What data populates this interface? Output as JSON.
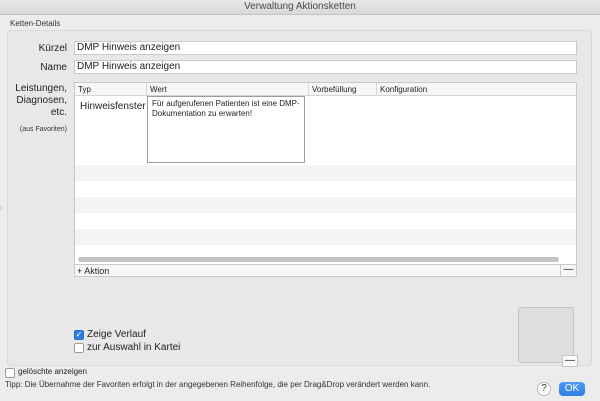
{
  "window": {
    "title": "Verwaltung Aktionsketten"
  },
  "group": {
    "title": "Ketten-Details"
  },
  "fields": {
    "kuerzel": {
      "label": "Kürzel",
      "value": "DMP Hinweis anzeigen"
    },
    "name": {
      "label": "Name",
      "value": "DMP Hinweis anzeigen"
    }
  },
  "leistungen": {
    "label_lines": [
      "Leistungen,",
      "Diagnosen,",
      "etc."
    ],
    "fav_note": "(aus Favoriten)"
  },
  "table": {
    "columns": [
      "Typ",
      "Wert",
      "Vorbefüllung",
      "Konfiguration"
    ],
    "rows": [
      {
        "typ": "Hinweisfenster",
        "wert": "Für aufgerufenen Patienten ist eine DMP-Dokumentation zu erwarten!",
        "vorbefuellung": "",
        "konfiguration": ""
      }
    ]
  },
  "table_bar": {
    "add_label": "+ Aktion",
    "remove_label": "—"
  },
  "options": {
    "zeige_verlauf": {
      "label": "Zeige Verlauf",
      "checked": true
    },
    "zur_auswahl": {
      "label": "zur Auswahl in Kartei",
      "checked": false
    }
  },
  "preview": {
    "remove_label": "—"
  },
  "footer": {
    "geloeschte": {
      "label": "gelöschte anzeigen",
      "checked": false
    },
    "tip": "Tipp: Die Übernahme der Favoriten erfolgt in der angegebenen Reihenfolge, die per Drag&Drop verändert werden kann.",
    "help_label": "?",
    "ok_label": "OK"
  },
  "colors": {
    "accent": "#2f7fe0",
    "stripe": "#f3f4f5"
  }
}
